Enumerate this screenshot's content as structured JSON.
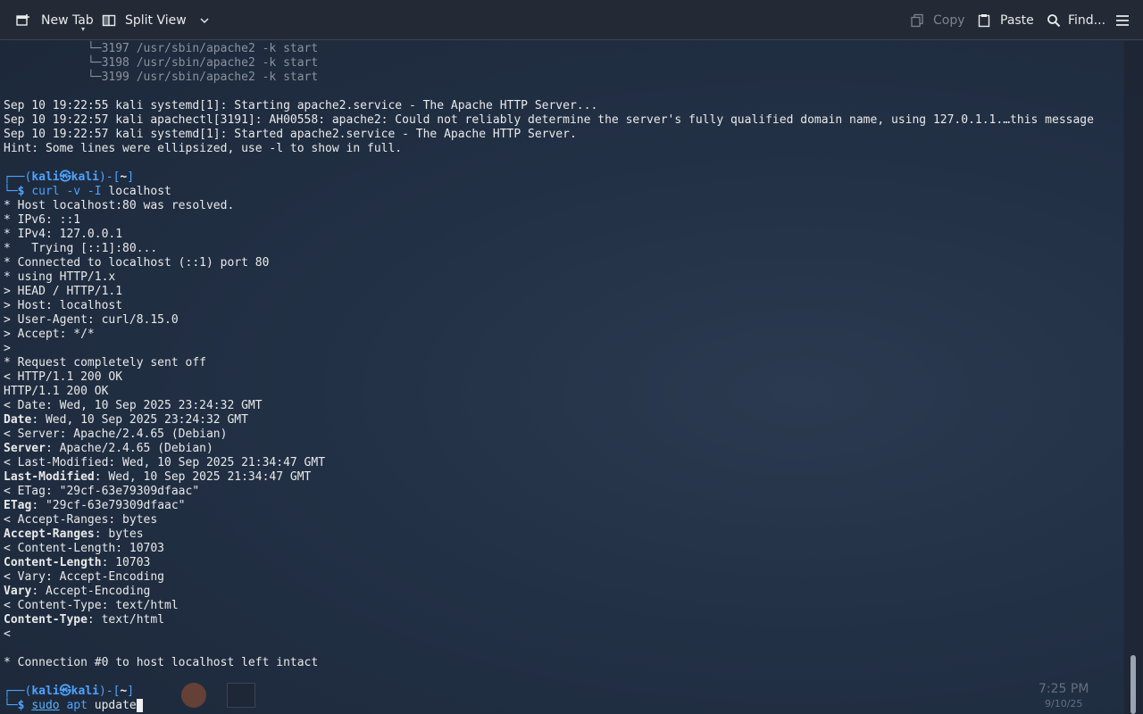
{
  "toolbar": {
    "new_tab": "New Tab",
    "split_view": "Split View",
    "copy": "Copy",
    "paste": "Paste",
    "find": "Find..."
  },
  "terminal_lines": [
    {
      "id": "l0",
      "parts": [
        {
          "t": "            └─",
          "c": "tree"
        },
        {
          "t": "3197 /usr/sbin/apache2 -k start",
          "c": "dim"
        }
      ]
    },
    {
      "id": "l1",
      "parts": [
        {
          "t": "            └─",
          "c": "tree"
        },
        {
          "t": "3198 /usr/sbin/apache2 -k start",
          "c": "dim"
        }
      ]
    },
    {
      "id": "l2",
      "parts": [
        {
          "t": "            └─",
          "c": "tree"
        },
        {
          "t": "3199 /usr/sbin/apache2 -k start",
          "c": "dim"
        }
      ]
    },
    {
      "id": "l3",
      "parts": [
        {
          "t": ""
        }
      ]
    },
    {
      "id": "l4",
      "parts": [
        {
          "t": "Sep 10 19:22:55 kali systemd[1]: Starting apache2.service - The Apache HTTP Server..."
        }
      ]
    },
    {
      "id": "l5",
      "parts": [
        {
          "t": "Sep 10 19:22:57 kali apachectl[3191]: AH00558: apache2: Could not reliably determine the server's fully qualified domain name, using 127.0.1.1.…this message"
        }
      ]
    },
    {
      "id": "l6",
      "parts": [
        {
          "t": "Sep 10 19:22:57 kali systemd[1]: Started apache2.service - The Apache HTTP Server."
        }
      ]
    },
    {
      "id": "l7",
      "parts": [
        {
          "t": "Hint: Some lines were ellipsized, use -l to show in full."
        }
      ]
    },
    {
      "id": "l8",
      "parts": [
        {
          "t": ""
        }
      ]
    },
    {
      "id": "l9",
      "parts": [
        {
          "t": "┌──(",
          "c": "blue"
        },
        {
          "t": "kali㉿kali",
          "c": "prompt-host"
        },
        {
          "t": ")-[",
          "c": "blue"
        },
        {
          "t": "~",
          "c": "bold"
        },
        {
          "t": "]",
          "c": "blue"
        }
      ]
    },
    {
      "id": "l10",
      "parts": [
        {
          "t": "└─",
          "c": "blue"
        },
        {
          "t": "$ ",
          "c": "prompt-dollar"
        },
        {
          "t": "curl",
          "c": "blue"
        },
        {
          "t": " -v -I ",
          "c": "blue"
        },
        {
          "t": "localhost"
        }
      ]
    },
    {
      "id": "l11",
      "parts": [
        {
          "t": "* Host localhost:80 was resolved."
        }
      ]
    },
    {
      "id": "l12",
      "parts": [
        {
          "t": "* IPv6: ::1"
        }
      ]
    },
    {
      "id": "l13",
      "parts": [
        {
          "t": "* IPv4: 127.0.0.1"
        }
      ]
    },
    {
      "id": "l14",
      "parts": [
        {
          "t": "*   Trying [::1]:80..."
        }
      ]
    },
    {
      "id": "l15",
      "parts": [
        {
          "t": "* Connected to localhost (::1) port 80"
        }
      ]
    },
    {
      "id": "l16",
      "parts": [
        {
          "t": "* using HTTP/1.x"
        }
      ]
    },
    {
      "id": "l17",
      "parts": [
        {
          "t": "> HEAD / HTTP/1.1"
        }
      ]
    },
    {
      "id": "l18",
      "parts": [
        {
          "t": "> Host: localhost"
        }
      ]
    },
    {
      "id": "l19",
      "parts": [
        {
          "t": "> User-Agent: curl/8.15.0"
        }
      ]
    },
    {
      "id": "l20",
      "parts": [
        {
          "t": "> Accept: */*"
        }
      ]
    },
    {
      "id": "l21",
      "parts": [
        {
          "t": ">"
        }
      ]
    },
    {
      "id": "l22",
      "parts": [
        {
          "t": "* Request completely sent off"
        }
      ]
    },
    {
      "id": "l23",
      "parts": [
        {
          "t": "< HTTP/1.1 200 OK"
        }
      ]
    },
    {
      "id": "l24",
      "parts": [
        {
          "t": "HTTP/1.1 200 OK"
        }
      ]
    },
    {
      "id": "l25",
      "parts": [
        {
          "t": "< Date: Wed, 10 Sep 2025 23:24:32 GMT"
        }
      ]
    },
    {
      "id": "l26",
      "parts": [
        {
          "t": "Date",
          "c": "bold"
        },
        {
          "t": ": Wed, 10 Sep 2025 23:24:32 GMT"
        }
      ]
    },
    {
      "id": "l27",
      "parts": [
        {
          "t": "< Server: Apache/2.4.65 (Debian)"
        }
      ]
    },
    {
      "id": "l28",
      "parts": [
        {
          "t": "Server",
          "c": "bold"
        },
        {
          "t": ": Apache/2.4.65 (Debian)"
        }
      ]
    },
    {
      "id": "l29",
      "parts": [
        {
          "t": "< Last-Modified: Wed, 10 Sep 2025 21:34:47 GMT"
        }
      ]
    },
    {
      "id": "l30",
      "parts": [
        {
          "t": "Last-Modified",
          "c": "bold"
        },
        {
          "t": ": Wed, 10 Sep 2025 21:34:47 GMT"
        }
      ]
    },
    {
      "id": "l31",
      "parts": [
        {
          "t": "< ETag: \"29cf-63e79309dfaac\""
        }
      ]
    },
    {
      "id": "l32",
      "parts": [
        {
          "t": "ETag",
          "c": "bold"
        },
        {
          "t": ": \"29cf-63e79309dfaac\""
        }
      ]
    },
    {
      "id": "l33",
      "parts": [
        {
          "t": "< Accept-Ranges: bytes"
        }
      ]
    },
    {
      "id": "l34",
      "parts": [
        {
          "t": "Accept-Ranges",
          "c": "bold"
        },
        {
          "t": ": bytes"
        }
      ]
    },
    {
      "id": "l35",
      "parts": [
        {
          "t": "< Content-Length: 10703"
        }
      ]
    },
    {
      "id": "l36",
      "parts": [
        {
          "t": "Content-Length",
          "c": "bold"
        },
        {
          "t": ": 10703"
        }
      ]
    },
    {
      "id": "l37",
      "parts": [
        {
          "t": "< Vary: Accept-Encoding"
        }
      ]
    },
    {
      "id": "l38",
      "parts": [
        {
          "t": "Vary",
          "c": "bold"
        },
        {
          "t": ": Accept-Encoding"
        }
      ]
    },
    {
      "id": "l39",
      "parts": [
        {
          "t": "< Content-Type: text/html"
        }
      ]
    },
    {
      "id": "l40",
      "parts": [
        {
          "t": "Content-Type",
          "c": "bold"
        },
        {
          "t": ": text/html"
        }
      ]
    },
    {
      "id": "l41",
      "parts": [
        {
          "t": "<"
        }
      ]
    },
    {
      "id": "l42",
      "parts": [
        {
          "t": ""
        }
      ]
    },
    {
      "id": "l43",
      "parts": [
        {
          "t": "* Connection #0 to host localhost left intact"
        }
      ]
    },
    {
      "id": "l44",
      "parts": [
        {
          "t": ""
        }
      ]
    },
    {
      "id": "l45",
      "parts": [
        {
          "t": "┌──(",
          "c": "blue"
        },
        {
          "t": "kali㉿kali",
          "c": "prompt-host"
        },
        {
          "t": ")-[",
          "c": "blue"
        },
        {
          "t": "~",
          "c": "bold"
        },
        {
          "t": "]",
          "c": "blue"
        }
      ]
    },
    {
      "id": "l46",
      "parts": [
        {
          "t": "└─",
          "c": "blue"
        },
        {
          "t": "$ ",
          "c": "prompt-dollar"
        },
        {
          "t": "sudo",
          "c": "under"
        },
        {
          "t": " apt ",
          "c": "blue"
        },
        {
          "t": "update"
        }
      ],
      "cursor": true
    }
  ],
  "taskbar_ghost": {
    "clock_time": "7:25 PM",
    "clock_date": "9/10/25"
  },
  "colors": {
    "accent": "#4ea3ff",
    "toolbar_bg": "#232a36"
  }
}
